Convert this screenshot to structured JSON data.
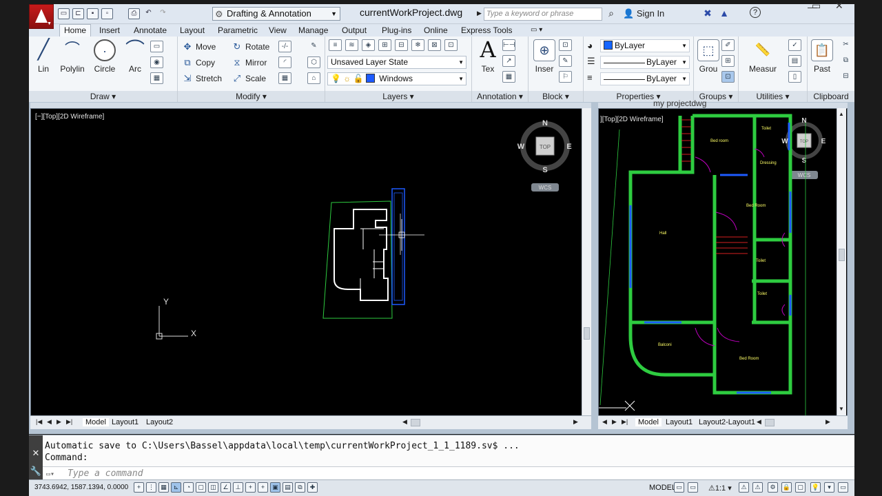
{
  "title_bar": {
    "workspace": "Drafting & Annotation",
    "document_title": "currentWorkProject.dwg",
    "search_placeholder": "Type a keyword or phrase",
    "sign_in": "Sign In"
  },
  "ribbon_tabs": [
    "Home",
    "Insert",
    "Annotate",
    "Layout",
    "Parametric",
    "View",
    "Manage",
    "Output",
    "Plug-ins",
    "Online",
    "Express Tools"
  ],
  "panels": {
    "draw": {
      "title": "Draw",
      "tools": [
        "Lin",
        "Polylin",
        "Circle",
        "Arc"
      ]
    },
    "modify": {
      "title": "Modify",
      "tools": [
        "Move",
        "Rotate",
        "Copy",
        "Mirror",
        "Stretch",
        "Scale"
      ]
    },
    "layers": {
      "title": "Layers",
      "layer_state": "Unsaved Layer State",
      "current_layer": "Windows"
    },
    "annotation": {
      "title": "Annotation",
      "tool": "Tex"
    },
    "block": {
      "title": "Block",
      "tool": "Inser"
    },
    "properties": {
      "title": "Properties",
      "color": "ByLayer",
      "linetype": "ByLayer",
      "lineweight": "ByLayer",
      "color_hex": "#1565ff"
    },
    "groups": {
      "title": "Groups",
      "tool": "Grou"
    },
    "utilities": {
      "title": "Utilities",
      "tool": "Measur"
    },
    "clipboard": {
      "title": "Clipboard",
      "tool": "Past"
    }
  },
  "viewport_left": {
    "header": "",
    "label": "[−][Top][2D Wireframe]",
    "compass": {
      "n": "N",
      "s": "S",
      "e": "E",
      "w": "W",
      "top": "TOP",
      "wcs": "WCS"
    },
    "ucs": {
      "x": "X",
      "y": "Y"
    },
    "tabs": [
      "Model",
      "Layout1",
      "Layout2"
    ]
  },
  "viewport_right": {
    "header": "my projectdwg",
    "label": "][Top][2D Wireframe]",
    "compass": {
      "n": "N",
      "s": "S",
      "e": "E",
      "w": "W",
      "top": "TOP",
      "wcs": "WCS"
    },
    "tabs": [
      "Model",
      "Layout1",
      "Layout2-Layout1"
    ],
    "rooms": [
      "Bed room",
      "Toilet",
      "Dressing",
      "Bed Room",
      "Hall",
      "Toilet",
      "Toilet",
      "Balconi",
      "Bed Room"
    ]
  },
  "command_line": {
    "history_1": "Automatic save to C:\\Users\\Bassel\\appdata\\local\\temp\\currentWorkProject_1_1_1189.sv$ ...",
    "history_2": "Command:",
    "placeholder": "Type a command"
  },
  "status_bar": {
    "coordinates": "3743.6942, 1587.1394, 0.0000",
    "space": "MODEL",
    "scale": "1:1"
  },
  "colors": {
    "plan_walls": "#2ecc40",
    "windows": "#1e5bff",
    "doors": "#c000c0",
    "room_text": "#ffff66"
  }
}
